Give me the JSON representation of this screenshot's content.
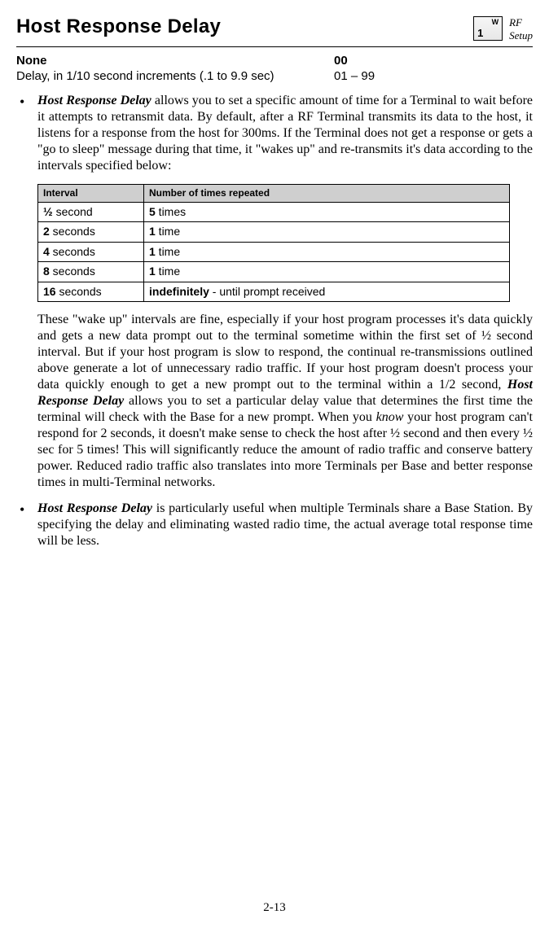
{
  "header": {
    "title": "Host Response Delay",
    "keyTop": "W",
    "keyBottom": "1",
    "metaLine1": "RF",
    "metaLine2": "Setup"
  },
  "settings": {
    "rows": [
      {
        "label": "None",
        "value": "00",
        "boldRow": true
      },
      {
        "label": "Delay, in 1/10 second increments (.1 to 9.9 sec)",
        "value": "01 – 99",
        "boldRow": false
      }
    ]
  },
  "bullet1": {
    "lead": "Host Response Delay",
    "rest": " allows you to set a specific amount of time for a Terminal to wait before it attempts to retransmit data.  By default, after a RF Terminal transmits its data to the host, it listens for a response from the host for 300ms. If the Terminal does not get a response or gets a \"go to sleep\" message during that time, it \"wakes up\" and re-transmits it's data according to the intervals specified below:"
  },
  "intervalTable": {
    "headers": [
      "Interval",
      "Number of times repeated"
    ],
    "rows": [
      {
        "intervalBold": "½",
        "intervalRest": " second",
        "timesBold": "5",
        "timesRest": " times"
      },
      {
        "intervalBold": "2",
        "intervalRest": " seconds",
        "timesBold": "1",
        "timesRest": " time"
      },
      {
        "intervalBold": "4",
        "intervalRest": " seconds",
        "timesBold": "1",
        "timesRest": " time"
      },
      {
        "intervalBold": "8",
        "intervalRest": " seconds",
        "timesBold": "1",
        "timesRest": " time"
      },
      {
        "intervalBold": "16",
        "intervalRest": " seconds",
        "timesBold": "indefinitely",
        "timesRest": " - until prompt received"
      }
    ]
  },
  "afterTable": {
    "part1": "These \"wake up\" intervals are fine, especially if your host program processes it's data quickly and gets a new data prompt out to the terminal sometime within the first set of ½ second interval. But if your host program is slow to respond, the continual re-transmissions outlined above generate a lot of unnecessary radio traffic. If your host program doesn't process your data quickly enough to get a new prompt out to the terminal within a 1/2 second, ",
    "emph": "Host Response Delay",
    "part2": " allows you to set a particular delay value that determines the first time the terminal will check with the Base for a new prompt. When you ",
    "know": "know",
    "part3": " your host program can't respond for 2 seconds, it doesn't make sense to check the host after ½ second and then every ½ sec for 5 times! This will significantly reduce the amount of radio traffic and conserve battery power.  Reduced radio traffic also translates into more Terminals per Base and better response times in multi-Terminal networks."
  },
  "bullet2": {
    "lead": "Host Response Delay",
    "rest": " is particularly useful when multiple Terminals share a Base Station.  By specifying the delay and eliminating wasted radio time, the actual average total response time will be less."
  },
  "pageNumber": "2-13"
}
